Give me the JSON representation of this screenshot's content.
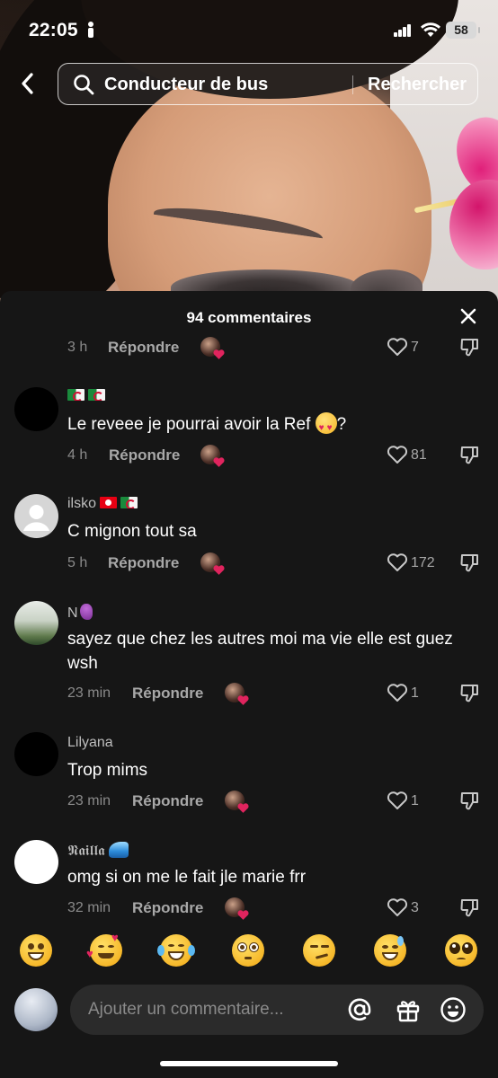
{
  "status": {
    "time": "22:05",
    "battery": "58"
  },
  "search": {
    "query": "Conducteur de bus",
    "submit_label": "Rechercher"
  },
  "comments_panel": {
    "title": "94 commentaires",
    "reply_label": "Répondre",
    "top_meta": {
      "time": "3 h",
      "likes": "7"
    },
    "comments": [
      {
        "author": "",
        "text": "Le reveee je pourrai avoir la Ref",
        "time": "4 h",
        "likes": "81"
      },
      {
        "author": "ilsko",
        "text": "C mignon tout sa",
        "time": "5 h",
        "likes": "172"
      },
      {
        "author": "N",
        "text": "sayez que chez les autres moi ma vie elle est guez wsh",
        "time": "23 min",
        "likes": "1"
      },
      {
        "author": "Lilyana",
        "text": "Trop mims",
        "time": "23 min",
        "likes": "1"
      },
      {
        "author": "𝕹𝖆𝖎𝖑𝖑𝖆",
        "text": "omg si on me le fait jle marie frr",
        "time": "32 min",
        "likes": "3"
      }
    ]
  },
  "emoji_bar": [
    "grinning-face",
    "smiling-face-with-hearts",
    "face-with-tears-of-joy",
    "flushed-face",
    "smirking-face",
    "grinning-face-with-sweat",
    "pleading-face"
  ],
  "composer": {
    "placeholder": "Ajouter un commentaire..."
  },
  "colors": {
    "panel_bg": "#161616",
    "like_heart": "#e0245e",
    "muted_text": "#8a8a8a"
  }
}
